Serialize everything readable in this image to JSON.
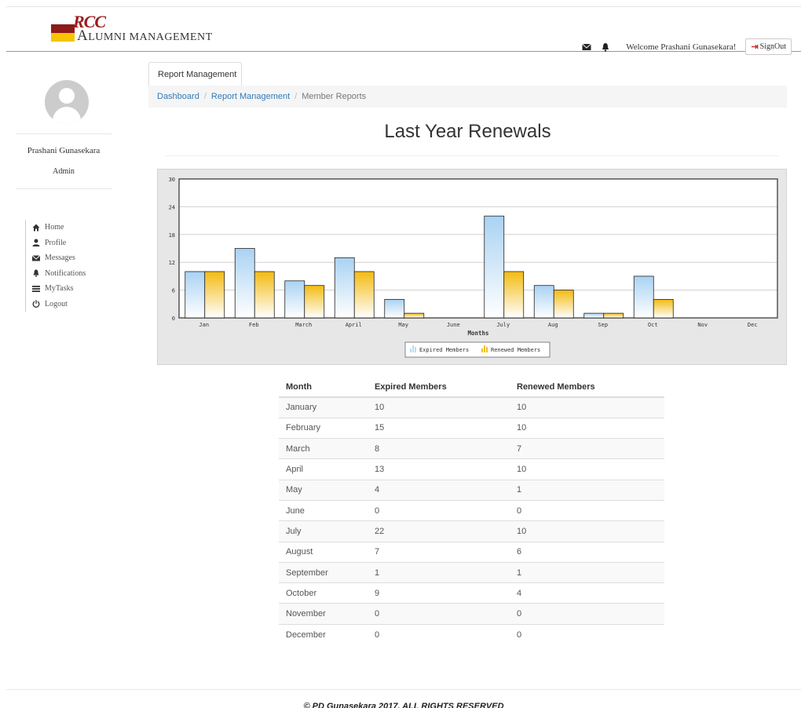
{
  "header": {
    "brand_mark": "RCC",
    "brand_title": "Alumni Management",
    "welcome": "Welcome Prashani Gunasekara!",
    "signout_label": "SignOut"
  },
  "sidebar": {
    "user_name": "Prashani Gunasekara",
    "user_role": "Admin",
    "items": [
      {
        "label": "Home",
        "icon": "home-icon"
      },
      {
        "label": "Profile",
        "icon": "user-icon"
      },
      {
        "label": "Messages",
        "icon": "envelope-icon"
      },
      {
        "label": "Notifications",
        "icon": "bell-icon"
      },
      {
        "label": "MyTasks",
        "icon": "list-icon"
      },
      {
        "label": "Logout",
        "icon": "power-icon"
      }
    ]
  },
  "tabs": [
    {
      "label": "Report Management"
    }
  ],
  "breadcrumb": [
    "Dashboard",
    "Report Management",
    "Member Reports"
  ],
  "page_title": "Last Year Renewals",
  "chart_data": {
    "type": "bar",
    "categories": [
      "Jan",
      "Feb",
      "March",
      "April",
      "May",
      "June",
      "July",
      "Aug",
      "Sep",
      "Oct",
      "Nov",
      "Dec"
    ],
    "series": [
      {
        "name": "Expired Members",
        "values": [
          10,
          15,
          8,
          13,
          4,
          0,
          22,
          7,
          1,
          9,
          0,
          0
        ],
        "color": "#b9dcf6"
      },
      {
        "name": "Renewed Members",
        "values": [
          10,
          10,
          7,
          10,
          1,
          0,
          10,
          6,
          1,
          4,
          0,
          0
        ],
        "color": "#f5c116"
      }
    ],
    "xlabel": "Months",
    "ylabel": "",
    "ylim": [
      0,
      30
    ],
    "yticks": [
      "0",
      "6",
      "12",
      "18",
      "24",
      "30"
    ],
    "grid": true,
    "legend_position": "bottom"
  },
  "table": {
    "headers": [
      "Month",
      "Expired Members",
      "Renewed Members"
    ],
    "rows": [
      [
        "January",
        "10",
        "10"
      ],
      [
        "February",
        "15",
        "10"
      ],
      [
        "March",
        "8",
        "7"
      ],
      [
        "April",
        "13",
        "10"
      ],
      [
        "May",
        "4",
        "1"
      ],
      [
        "June",
        "0",
        "0"
      ],
      [
        "July",
        "22",
        "10"
      ],
      [
        "August",
        "7",
        "6"
      ],
      [
        "September",
        "1",
        "1"
      ],
      [
        "October",
        "9",
        "4"
      ],
      [
        "November",
        "0",
        "0"
      ],
      [
        "December",
        "0",
        "0"
      ]
    ]
  },
  "footer": {
    "text": "© PD Gunasekara 2017. ALL RIGHTS RESERVED"
  }
}
